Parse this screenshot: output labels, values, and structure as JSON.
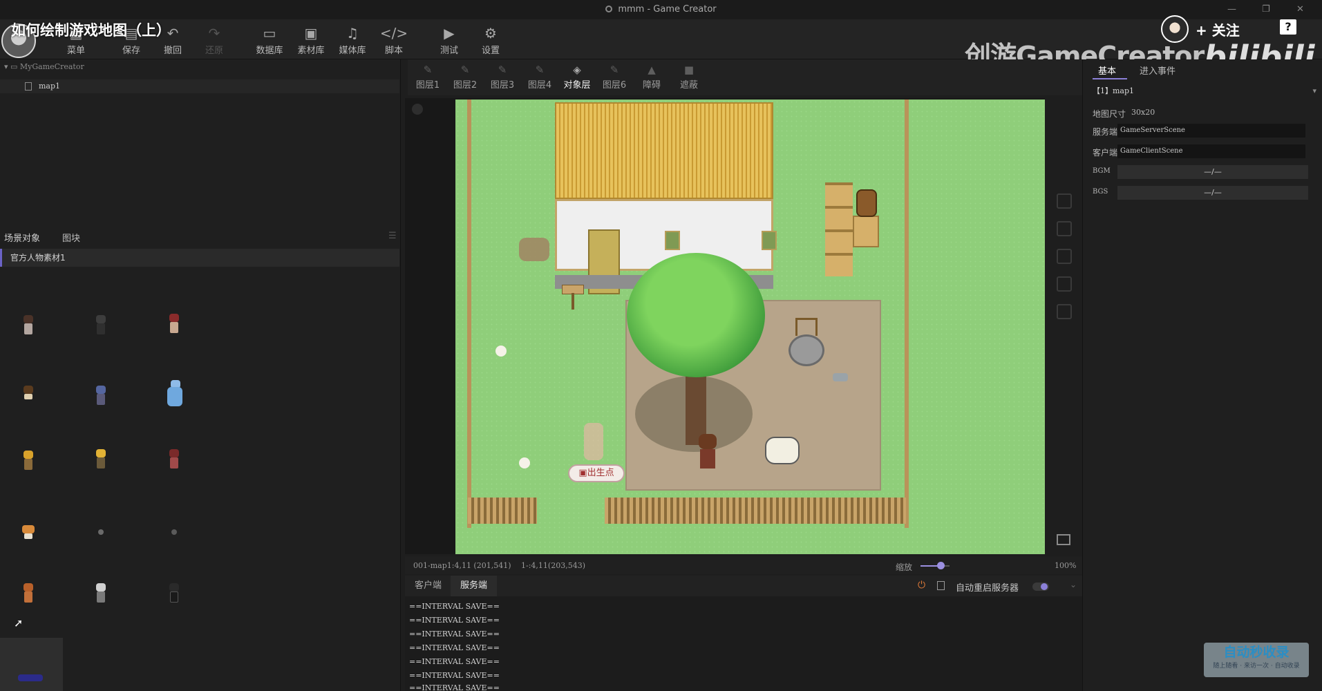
{
  "window": {
    "title": "mmm - Game Creator",
    "controls": [
      "—",
      "❐",
      "✕"
    ]
  },
  "video_overlay": {
    "episode_title": "如何绘制游戏地图（上）",
    "brand": "创游GameCreator",
    "platform": "bilibili",
    "follow_label": "+ 关注",
    "help_label": "?",
    "corner_wm": "自动秒收录",
    "corner_wm_sub": "随上随看 · 来访一次 · 自动收录"
  },
  "toolbar": [
    {
      "label": "菜单",
      "icon": "menu-icon"
    },
    {
      "label": "保存",
      "icon": "save-icon"
    },
    {
      "label": "撤回",
      "icon": "undo-icon"
    },
    {
      "label": "还原",
      "icon": "redo-icon",
      "disabled": true
    },
    {
      "label": "数据库",
      "icon": "database-icon"
    },
    {
      "label": "素材库",
      "icon": "assets-icon"
    },
    {
      "label": "媒体库",
      "icon": "music-icon"
    },
    {
      "label": "脚本",
      "icon": "code-icon"
    },
    {
      "label": "测试",
      "icon": "play-icon"
    },
    {
      "label": "设置",
      "icon": "gear-icon"
    }
  ],
  "project_tree": {
    "root": "MyGameCreator",
    "items": [
      "map1"
    ]
  },
  "left_tabs": [
    "场景对象",
    "图块"
  ],
  "object_group": "官方人物素材1",
  "layer_tabs": [
    "图层1",
    "图层2",
    "图层3",
    "图层4",
    "对象层",
    "图层6",
    "障碍",
    "遮蔽"
  ],
  "active_layer": "对象层",
  "map_labels": {
    "spawn_point": "出生点"
  },
  "status": {
    "cursor_info": "001-map1:4,11 (201,541)",
    "tile_info": "1-:4,11(203,543)",
    "zoom_label": "缩放",
    "zoom_value": "100%",
    "zoom_fraction": 0.7
  },
  "console": {
    "tabs": [
      "客户端",
      "服务端"
    ],
    "active_tab": "服务端",
    "auto_restart_label": "自动重启服务器",
    "lines": [
      "==INTERVAL SAVE==",
      "==INTERVAL SAVE==",
      "==INTERVAL SAVE==",
      "==INTERVAL SAVE==",
      "==INTERVAL SAVE==",
      "==INTERVAL SAVE==",
      "==INTERVAL SAVE=="
    ]
  },
  "properties": {
    "tabs": [
      "基本",
      "进入事件"
    ],
    "selected_map": "【1】map1",
    "map_size_label": "地图尺寸",
    "map_size_value": "30x20",
    "server_label": "服务端",
    "server_value": "GameServerScene",
    "client_label": "客户端",
    "client_value": "GameClientScene",
    "bgm_label": "BGM",
    "bgm_value": "—/—",
    "bgs_label": "BGS",
    "bgs_value": "—/—"
  },
  "colors": {
    "accent": "#8b80d8",
    "grass": "#8fce7a",
    "power": "#e07a38"
  }
}
